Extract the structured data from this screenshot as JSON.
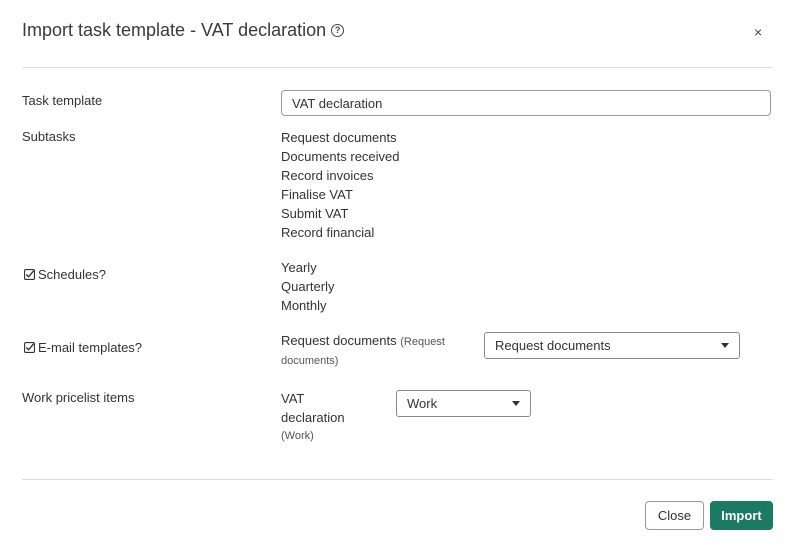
{
  "dialog": {
    "title": "Import task template - VAT declaration",
    "help_icon": "?",
    "close_icon": "×"
  },
  "task_template": {
    "label": "Task template",
    "value": "VAT declaration"
  },
  "subtasks": {
    "label": "Subtasks",
    "items": [
      "Request documents",
      "Documents received",
      "Record invoices",
      "Finalise VAT",
      "Submit VAT",
      "Record financial"
    ]
  },
  "schedules": {
    "label": "Schedules?",
    "items": [
      "Yearly",
      "Quarterly",
      "Monthly"
    ]
  },
  "email_templates": {
    "label": "E-mail templates?",
    "item_name": "Request documents",
    "item_detail_open": "(Request",
    "item_detail_close": "documents)",
    "select_value": "Request documents"
  },
  "work_pricelist": {
    "label": "Work pricelist items",
    "item_line1": "VAT",
    "item_line2": "declaration",
    "item_detail": "(Work)",
    "select_value": "Work"
  },
  "footer": {
    "close_label": "Close",
    "import_label": "Import"
  },
  "colors": {
    "primary": "#1b7a61"
  }
}
